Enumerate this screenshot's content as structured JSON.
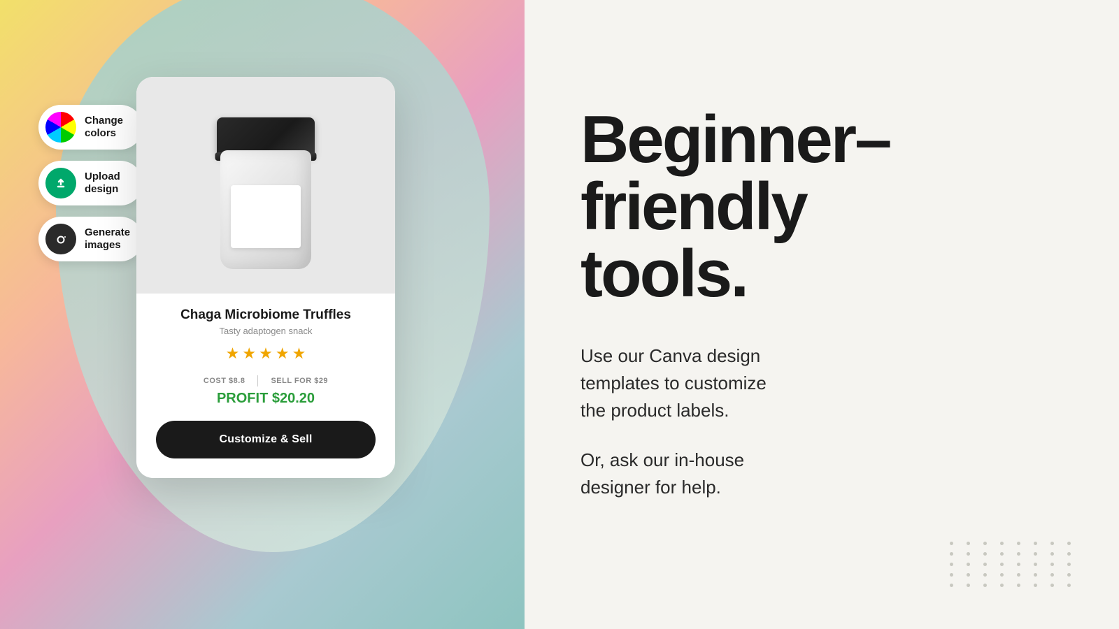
{
  "left": {
    "tools": [
      {
        "id": "change-colors",
        "icon_type": "colors",
        "label": "Change\ncolors"
      },
      {
        "id": "upload-design",
        "icon_type": "upload",
        "label": "Upload\ndesign"
      },
      {
        "id": "generate-images",
        "icon_type": "camera",
        "label": "Generate\nimages"
      }
    ],
    "card": {
      "product_name": "Chaga Microbiome Truffles",
      "product_subtitle": "Tasty adaptogen snack",
      "stars": 5,
      "cost_label": "COST $8.8",
      "sell_label": "SELL FOR $29",
      "profit_label": "PROFIT $20.20",
      "cta_label": "Customize & Sell"
    }
  },
  "right": {
    "heading_line1": "Beginner–",
    "heading_line2": "friendly",
    "heading_line3": "tools.",
    "description1": "Use our Canva design\ntemplates to customize\nthe product labels.",
    "description2": "Or, ask our in-house\ndesigner for help."
  }
}
